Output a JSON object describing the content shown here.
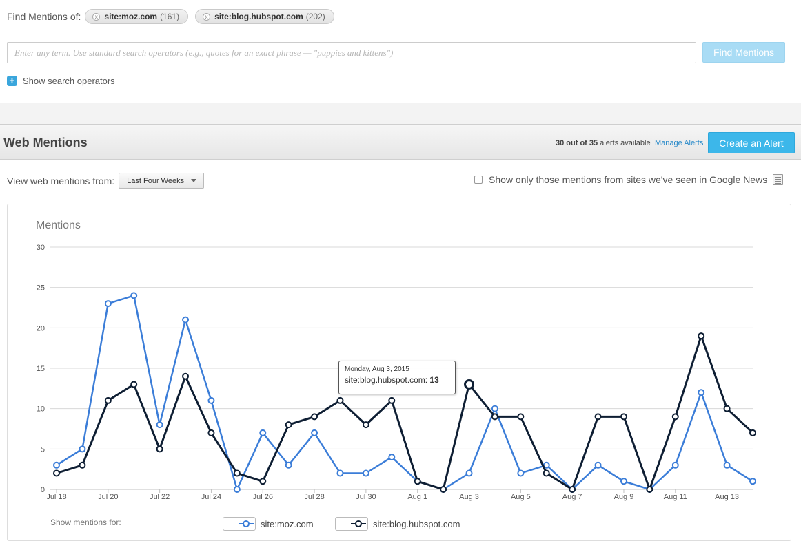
{
  "search": {
    "find_label": "Find Mentions of:",
    "chips": [
      {
        "term": "site:moz.com",
        "count": "(161)"
      },
      {
        "term": "site:blog.hubspot.com",
        "count": "(202)"
      }
    ],
    "placeholder": "Enter any term. Use standard search operators (e.g., quotes for an exact phrase — \"puppies and kittens\")",
    "button_label": "Find Mentions",
    "operators_label": "Show search operators"
  },
  "section": {
    "title": "Web Mentions",
    "alerts_count": "30 out of 35",
    "alerts_suffix": " alerts available",
    "manage_label": "Manage Alerts",
    "create_label": "Create an Alert"
  },
  "filters": {
    "view_label": "View web mentions from:",
    "range_value": "Last Four Weeks",
    "news_label": "Show only those mentions from sites we've seen in Google News"
  },
  "chart_data": {
    "type": "line",
    "title": "Mentions",
    "ylim": [
      0,
      30
    ],
    "yticks": [
      0,
      5,
      10,
      15,
      20,
      25,
      30
    ],
    "x": [
      "Jul 18",
      "Jul 19",
      "Jul 20",
      "Jul 21",
      "Jul 22",
      "Jul 23",
      "Jul 24",
      "Jul 25",
      "Jul 26",
      "Jul 27",
      "Jul 28",
      "Jul 29",
      "Jul 30",
      "Jul 31",
      "Aug 1",
      "Aug 2",
      "Aug 3",
      "Aug 4",
      "Aug 5",
      "Aug 6",
      "Aug 7",
      "Aug 8",
      "Aug 9",
      "Aug 10",
      "Aug 11",
      "Aug 12",
      "Aug 13",
      "Aug 14"
    ],
    "xticks": [
      "Jul 18",
      "Jul 20",
      "Jul 22",
      "Jul 24",
      "Jul 26",
      "Jul 28",
      "Jul 30",
      "Aug 1",
      "Aug 3",
      "Aug 5",
      "Aug 7",
      "Aug 9",
      "Aug 11",
      "Aug 13"
    ],
    "grid": true,
    "series": [
      {
        "name": "site:moz.com",
        "color": "#3b7dd8",
        "values": [
          3,
          5,
          23,
          24,
          8,
          21,
          11,
          0,
          7,
          3,
          7,
          2,
          2,
          4,
          1,
          0,
          2,
          10,
          2,
          3,
          0,
          3,
          1,
          0,
          3,
          12,
          3,
          1
        ]
      },
      {
        "name": "site:blog.hubspot.com",
        "color": "#0e1e33",
        "values": [
          2,
          3,
          11,
          13,
          5,
          14,
          7,
          2,
          1,
          8,
          9,
          11,
          8,
          11,
          1,
          0,
          13,
          9,
          9,
          2,
          0,
          9,
          9,
          0,
          9,
          19,
          10,
          7
        ]
      }
    ],
    "tooltip": {
      "date": "Monday, Aug 3, 2015",
      "series": "site:blog.hubspot.com:",
      "value": "13"
    }
  },
  "legend": {
    "caption": "Show mentions for:",
    "items": [
      "site:moz.com",
      "site:blog.hubspot.com"
    ]
  }
}
